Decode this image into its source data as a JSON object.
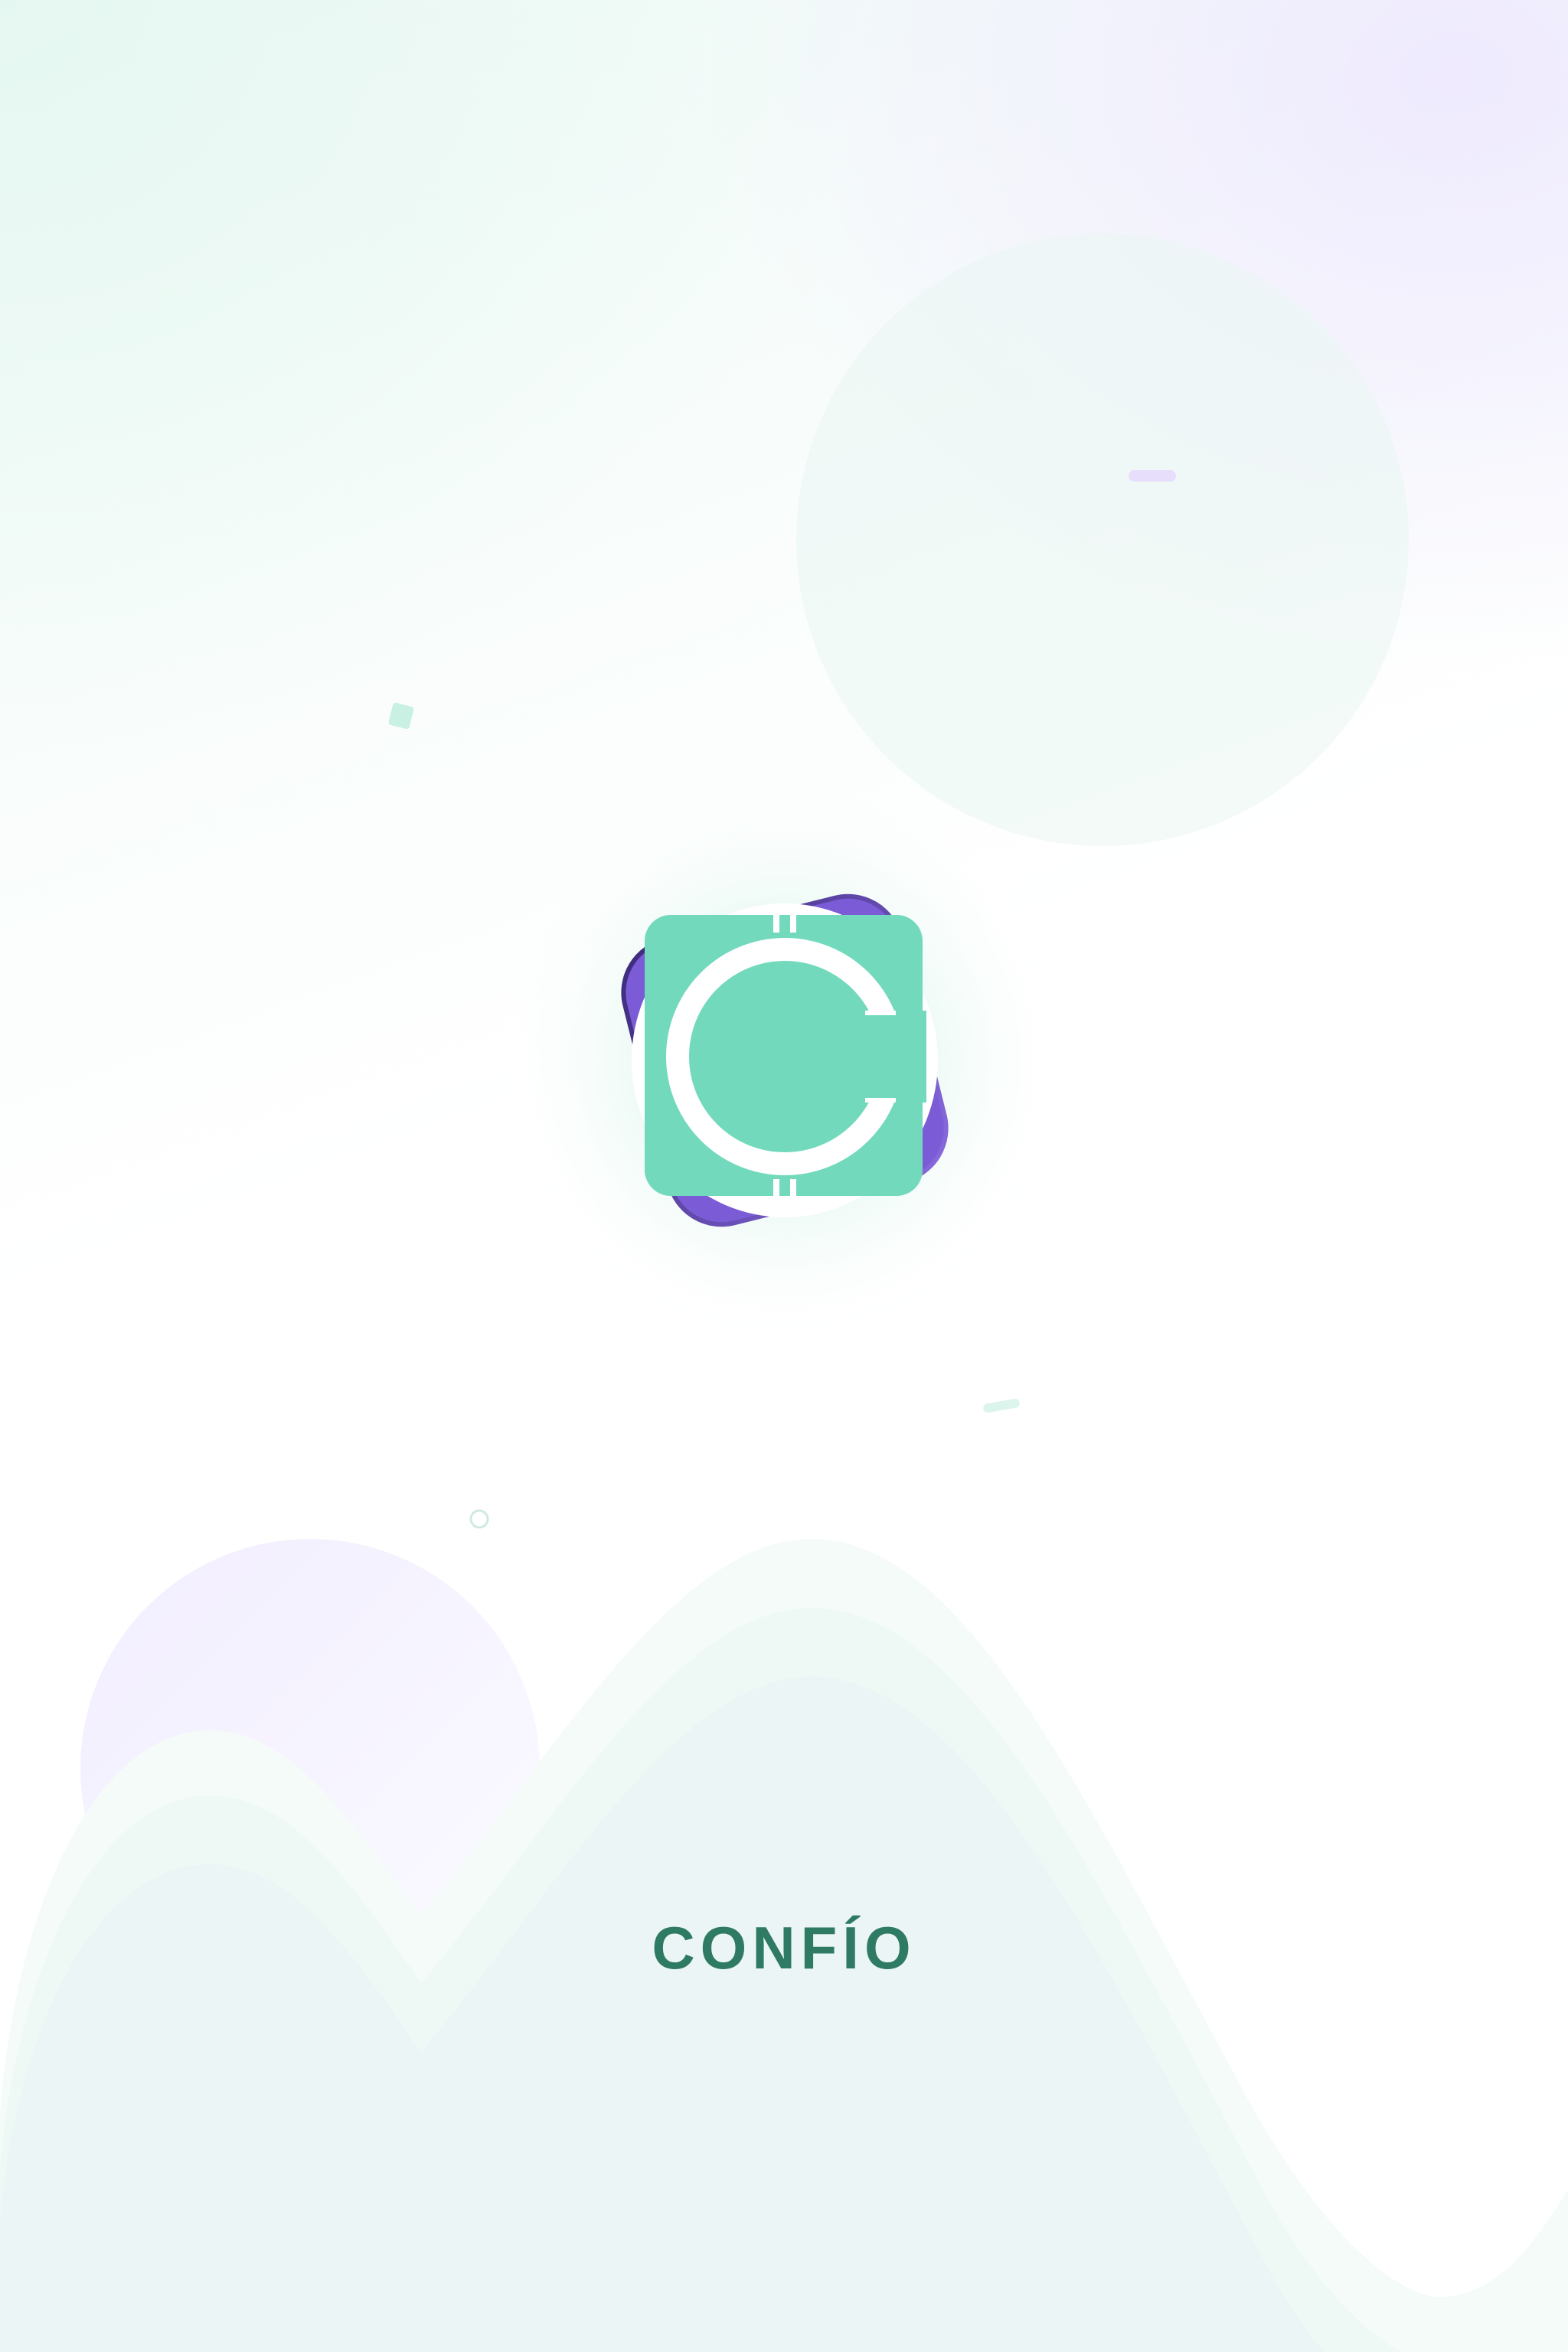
{
  "app": {
    "name": "CONFÍO",
    "logo_letter": "C"
  },
  "theme": {
    "brand_color": "#72d9bd",
    "brand_text_color": "#2f7a63",
    "accent_purple": "#7b5cd6",
    "accent_purple_dark": "#3b2a7a"
  },
  "decorations": {
    "confetti": [
      "small-teal-square",
      "lavender-dash",
      "mint-dash",
      "outline-circle"
    ]
  }
}
